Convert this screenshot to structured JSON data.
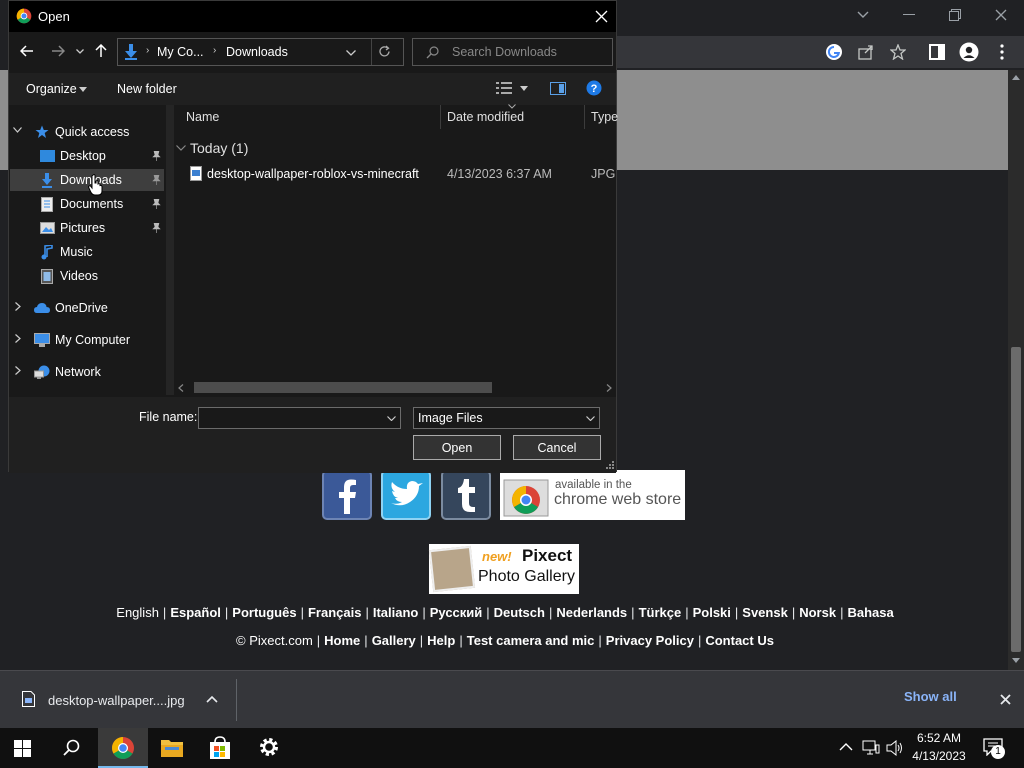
{
  "colors": {
    "chrome_bg": "#202124",
    "dialog_bg": "#191919",
    "accent": "#8ab4f8",
    "selection": "#3e3e3e"
  },
  "chrome": {
    "download_file": "desktop-wallpaper....jpg",
    "show_all": "Show all"
  },
  "page": {
    "cws_line1": "available in the",
    "cws_line2": "chrome web store",
    "gallery_new": "new!",
    "gallery_title1": "Pixect",
    "gallery_title2": "Photo Gallery",
    "languages": [
      "English",
      "Español",
      "Português",
      "Français",
      "Italiano",
      "Русский",
      "Deutsch",
      "Nederlands",
      "Türkçe",
      "Polski",
      "Svensk",
      "Norsk",
      "Bahasa"
    ],
    "copyright": "© Pixect.com",
    "footer_links": [
      "Home",
      "Gallery",
      "Help",
      "Test camera and mic",
      "Privacy Policy",
      "Contact Us"
    ]
  },
  "dialog": {
    "title": "Open",
    "breadcrumb": [
      "My Co...",
      "Downloads"
    ],
    "search_placeholder": "Search Downloads",
    "organize": "Organize",
    "new_folder": "New folder",
    "nav": {
      "quick_access": "Quick access",
      "desktop": "Desktop",
      "downloads": "Downloads",
      "documents": "Documents",
      "pictures": "Pictures",
      "music": "Music",
      "videos": "Videos",
      "onedrive": "OneDrive",
      "my_computer": "My Computer",
      "network": "Network"
    },
    "columns": {
      "name": "Name",
      "date": "Date modified",
      "type": "Type"
    },
    "group": "Today (1)",
    "files": [
      {
        "name": "desktop-wallpaper-roblox-vs-minecraft",
        "date": "4/13/2023 6:37 AM",
        "type": "JPG F"
      }
    ],
    "file_name_label": "File name:",
    "file_name_value": "",
    "filter": "Image Files",
    "open_button": "Open",
    "cancel_button": "Cancel"
  },
  "taskbar": {
    "time": "6:52 AM",
    "date": "4/13/2023",
    "notification_count": "1"
  }
}
